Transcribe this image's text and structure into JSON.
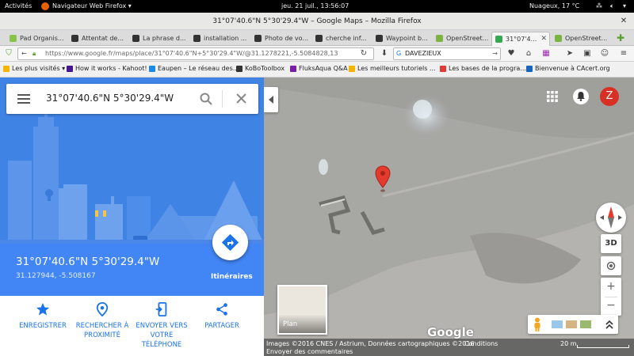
{
  "topbar": {
    "activities": "Activités",
    "app_menu": "Navigateur Web Firefox ▾",
    "clock": "jeu. 21 juil., 13:56:07",
    "weather": "Nuageux, 17 °C"
  },
  "window": {
    "title": "31°07'40.6\"N 5°30'29.4\"W – Google Maps – Mozilla Firefox"
  },
  "tabs": [
    {
      "label": "Pad Organis..."
    },
    {
      "label": "Attentat de..."
    },
    {
      "label": "La phrase d..."
    },
    {
      "label": "installation ..."
    },
    {
      "label": "Photo de vo..."
    },
    {
      "label": "cherche inf..."
    },
    {
      "label": "Waypoint b..."
    },
    {
      "label": "OpenStreet..."
    },
    {
      "label": "31°07'4..."
    },
    {
      "label": "OpenStreet..."
    }
  ],
  "navbar": {
    "url": "https://www.google.fr/maps/place/31°07'40.6\"N+5°30'29.4\"W/@31.1278221,-5.5084828,13",
    "search_value": "DAVEZIEUX"
  },
  "bookmarks": [
    {
      "label": "Les plus visités ▾"
    },
    {
      "label": "How it works - Kahoot!"
    },
    {
      "label": "Eaupen – Le réseau des..."
    },
    {
      "label": "KoBoToolbox"
    },
    {
      "label": "FluksAqua Q&A"
    },
    {
      "label": "Les meilleurs tutoriels ..."
    },
    {
      "label": "Les bases de la progra..."
    },
    {
      "label": "Bienvenue à CAcert.org"
    }
  ],
  "panel": {
    "search_value": "31°07'40.6\"N 5°30'29.4\"W",
    "place_title": "31°07'40.6\"N 5°30'29.4\"W",
    "place_coords": "31.127944, -5.508167",
    "directions_label": "Itinéraires",
    "actions": [
      {
        "label": "ENREGISTRER"
      },
      {
        "label": "RECHERCHER À PROXIMITÉ"
      },
      {
        "label": "ENVOYER VERS VOTRE TÉLÉPHONE"
      },
      {
        "label": "PARTAGER"
      }
    ]
  },
  "map": {
    "avatar_letter": "Z",
    "btn_3d": "3D",
    "layer_label": "Plan",
    "logo": "Google",
    "attribution": "Images ©2016 CNES / Astrium, Données cartographiques ©2016",
    "conditions": "Conditions",
    "feedback": "Envoyer des commentaires",
    "scale": "20 m"
  },
  "colors": {
    "panel_blue": "#4285f4",
    "accent_blue": "#1a73e8",
    "pin_red": "#e33b2e",
    "avatar_red": "#d93025"
  }
}
